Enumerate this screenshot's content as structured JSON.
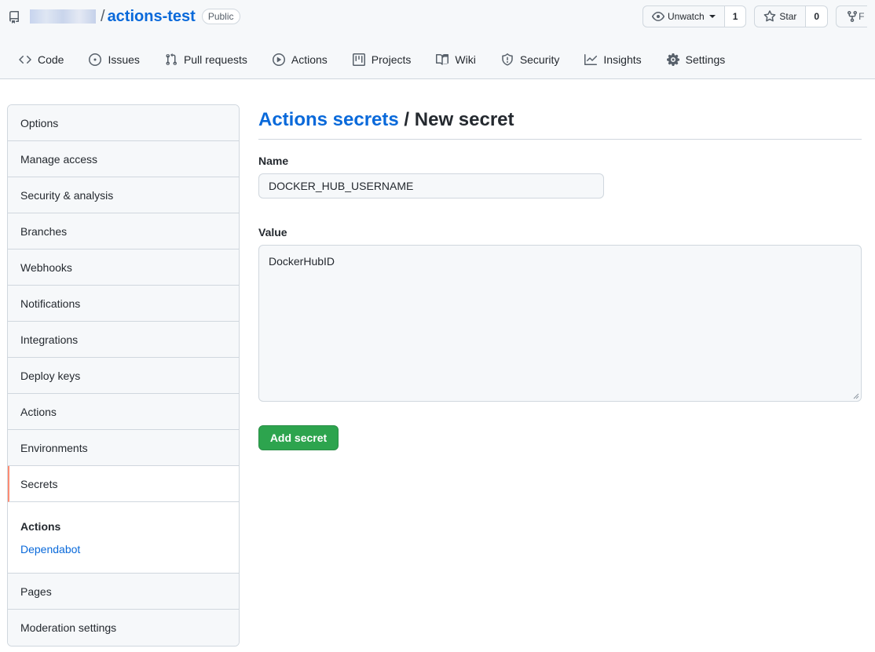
{
  "header": {
    "repo_name": "actions-test",
    "separator": "/",
    "visibility_badge": "Public",
    "unwatch_label": "Unwatch",
    "watch_count": "1",
    "star_label": "Star",
    "star_count": "0",
    "fork_stub": "F"
  },
  "tabs": [
    {
      "label": "Code",
      "icon": "code-icon"
    },
    {
      "label": "Issues",
      "icon": "issue-icon"
    },
    {
      "label": "Pull requests",
      "icon": "pull-request-icon"
    },
    {
      "label": "Actions",
      "icon": "play-icon"
    },
    {
      "label": "Projects",
      "icon": "project-icon"
    },
    {
      "label": "Wiki",
      "icon": "book-icon"
    },
    {
      "label": "Security",
      "icon": "shield-icon"
    },
    {
      "label": "Insights",
      "icon": "graph-icon"
    },
    {
      "label": "Settings",
      "icon": "gear-icon"
    }
  ],
  "sidebar": {
    "items": [
      "Options",
      "Manage access",
      "Security & analysis",
      "Branches",
      "Webhooks",
      "Notifications",
      "Integrations",
      "Deploy keys",
      "Actions",
      "Environments",
      "Secrets"
    ],
    "selected": "Secrets",
    "sub_heading": "Actions",
    "sub_link": "Dependabot",
    "bottom_items": [
      "Pages",
      "Moderation settings"
    ]
  },
  "main": {
    "breadcrumb_link": "Actions secrets",
    "breadcrumb_sep": " / ",
    "breadcrumb_current": "New secret",
    "name_label": "Name",
    "name_value": "DOCKER_HUB_USERNAME",
    "value_label": "Value",
    "value_value": "DockerHubID",
    "submit_label": "Add secret"
  },
  "colors": {
    "accent": "#0969da",
    "primary_button": "#2da44e",
    "selected_marker": "#fd8c73"
  }
}
